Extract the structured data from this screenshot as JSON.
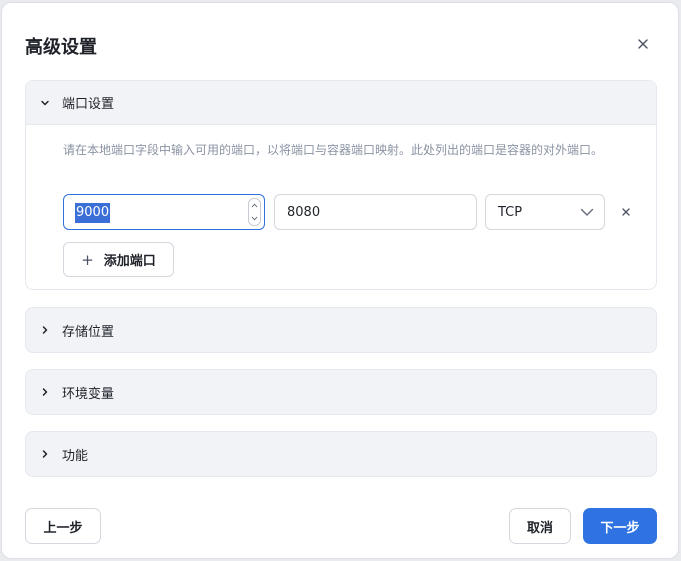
{
  "dialog": {
    "title": "高级设置",
    "close_icon": "close-icon"
  },
  "sections": {
    "ports": {
      "label": "端口设置",
      "expanded": true,
      "description": "请在本地端口字段中输入可用的端口，以将端口与容器端口映射。此处列出的端口是容器的对外端口。",
      "rows": [
        {
          "local_port": "9000",
          "container_port": "8080",
          "protocol": "TCP"
        }
      ],
      "add_label": "添加端口"
    },
    "storage": {
      "label": "存储位置",
      "expanded": false
    },
    "env": {
      "label": "环境变量",
      "expanded": false
    },
    "features": {
      "label": "功能",
      "expanded": false
    }
  },
  "footer": {
    "prev_label": "上一步",
    "cancel_label": "取消",
    "next_label": "下一步"
  },
  "colors": {
    "primary": "#2f73e3",
    "selection": "#3a6fd8",
    "section_bg": "#f1f3f7",
    "muted_text": "#8a93a3"
  }
}
